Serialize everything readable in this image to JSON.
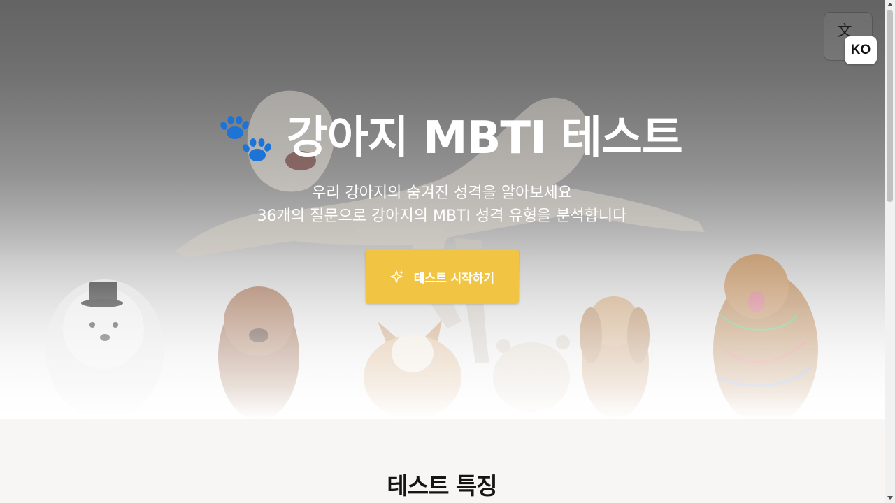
{
  "header": {
    "language_icon": "translate-icon",
    "language_code": "KO"
  },
  "hero": {
    "title_icon": "paw-icon",
    "title": "강아지 MBTI 테스트",
    "subtitle_line1": "우리 강아지의 숨겨진 성격을 알아보세요",
    "subtitle_line2": "36개의 질문으로 강아지의 MBTI 성격 유형을 분석합니다",
    "start_button_icon": "sparkle-icon",
    "start_button_label": "테스트 시작하기"
  },
  "features": {
    "title": "테스트 특징"
  },
  "colors": {
    "accent": "#f2c443",
    "paw": "#1e74d6",
    "title_text": "#ffffff",
    "section_bg": "#f7f6f4"
  }
}
